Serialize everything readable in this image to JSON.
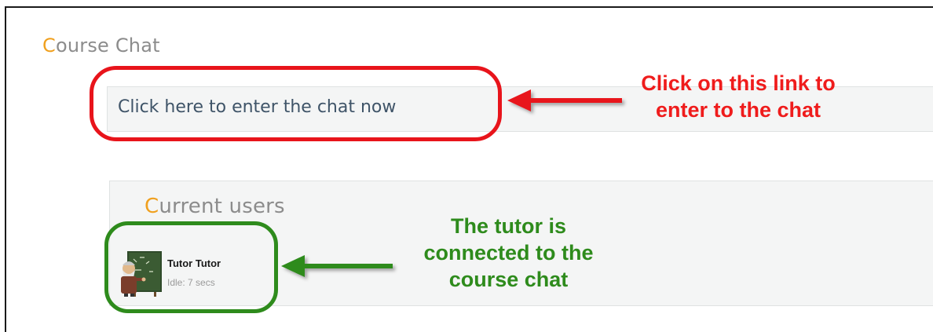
{
  "course_chat": {
    "title_initial": "C",
    "title_rest": "ourse Chat",
    "enter_link": "Click here to enter the chat now"
  },
  "current_users": {
    "title_initial": "C",
    "title_rest": "urrent users",
    "users": [
      {
        "name": "Tutor Tutor",
        "status": "Idle: 7 secs"
      }
    ]
  },
  "annotations": {
    "red_note_line1": "Click on this link to",
    "red_note_line2": "enter to the chat",
    "green_note_line1": "The tutor is",
    "green_note_line2": "connected to the",
    "green_note_line3": "course chat"
  },
  "colors": {
    "heading_gray": "#8c8c8c",
    "heading_initial": "#f0a01e",
    "link": "#3f5468",
    "annotation_red": "#e8141b",
    "annotation_green": "#2e8b1c"
  }
}
